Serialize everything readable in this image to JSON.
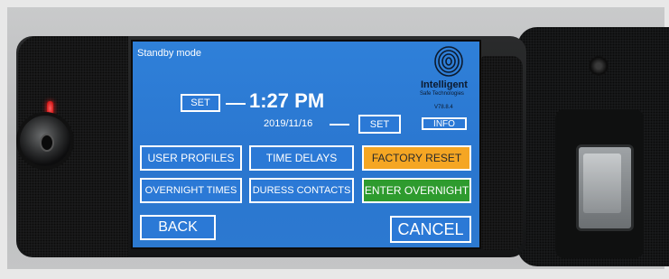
{
  "screen": {
    "mode_label": "Standby mode",
    "time": "1:27 PM",
    "date": "2019/11/16",
    "brand": "Intelligent",
    "brand_subtitle": "Safe Technologies",
    "version": "V78.8.4"
  },
  "buttons": {
    "set_time": "SET",
    "set_date": "SET",
    "info": "INFO",
    "user_profiles": "USER PROFILES",
    "time_delays": "TIME DELAYS",
    "factory_reset": "FACTORY RESET",
    "overnight_times": "OVERNIGHT TIMES",
    "duress_contacts": "DURESS CONTACTS",
    "enter_overnight": "ENTER OVERNIGHT",
    "back": "BACK",
    "cancel": "CANCEL"
  },
  "colors": {
    "screen_blue": "#2f80d9",
    "factory_reset": "#f5a623",
    "enter_overnight": "#2e9b2e"
  },
  "icons": {
    "logo": "fingerprint-icon"
  }
}
